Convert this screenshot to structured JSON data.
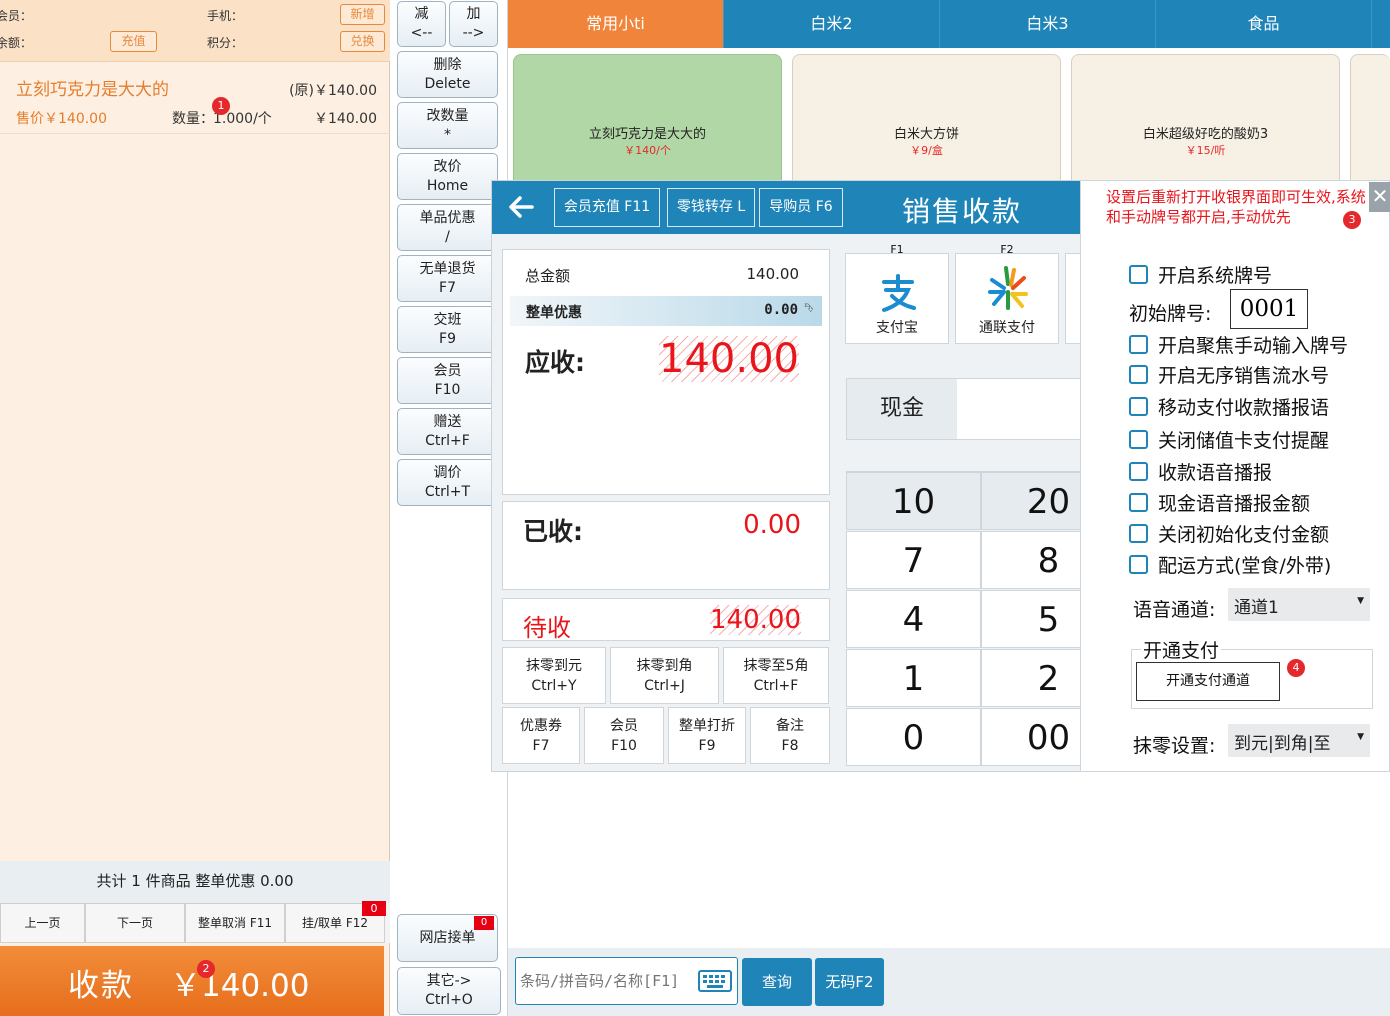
{
  "member_panel": {
    "member_label": "会员：",
    "phone_label": "手机：",
    "balance_label": "余额：",
    "points_label": "积分：",
    "new_button": "新增",
    "recharge_button": "充值",
    "redeem_button": "兑换"
  },
  "cart": {
    "items": [
      {
        "name": "立刻巧克力是大大的",
        "original_price": "(原)￥140.00",
        "sale_price": "售价￥140.00",
        "quantity_label": "数量：",
        "quantity": "1.000/个",
        "total": "￥140.00"
      }
    ],
    "summary": "共计 1 件商品 整单优惠 0.00",
    "pager": {
      "prev": "上一页",
      "next": "下一页",
      "cancel_order": "整单取消 F11",
      "hold_order": "挂/取单 F12",
      "hold_count": "0"
    },
    "pay_button_label": "收款",
    "pay_button_amount": "￥140.00"
  },
  "badges": [
    "1",
    "2",
    "3",
    "4"
  ],
  "function_buttons": {
    "decrease": {
      "line1": "减",
      "line2": "<--"
    },
    "increase": {
      "line1": "加",
      "line2": "-->"
    },
    "items": [
      {
        "line1": "删除",
        "line2": "Delete"
      },
      {
        "line1": "改数量",
        "line2": "*"
      },
      {
        "line1": "改价",
        "line2": "Home"
      },
      {
        "line1": "单品优惠",
        "line2": "/"
      },
      {
        "line1": "无单退货",
        "line2": "F7"
      },
      {
        "line1": "交班",
        "line2": "F9"
      },
      {
        "line1": "会员",
        "line2": "F10"
      },
      {
        "line1": "赠送",
        "line2": "Ctrl+F"
      },
      {
        "line1": "调价",
        "line2": "Ctrl+T"
      }
    ],
    "online_orders": "网店接单",
    "online_orders_count": "0",
    "other": {
      "line1": "其它->",
      "line2": "Ctrl+O"
    }
  },
  "categories": [
    {
      "label": "常用小ti",
      "active": true
    },
    {
      "label": "白米2",
      "active": false
    },
    {
      "label": "白米3",
      "active": false
    },
    {
      "label": "食品",
      "active": false
    }
  ],
  "products": [
    {
      "name": "立刻巧克力是大大的",
      "price": "￥140/个",
      "selected": true
    },
    {
      "name": "白米大方饼",
      "price": "￥9/盒",
      "selected": false
    },
    {
      "name": "白米超级好吃的酸奶3",
      "price": "￥15/听",
      "selected": false
    }
  ],
  "bottom_bar": {
    "search_placeholder": "条码/拼音码/名称[F1]",
    "query_button": "查询",
    "no_code_button": "无码F2",
    "keyboard_icon": "keyboard-icon"
  },
  "payment_dialog": {
    "title": "销售收款",
    "header_buttons": [
      "会员充值 F11",
      "零钱转存 L",
      "导购员 F6"
    ],
    "total_label": "总金额",
    "total": "140.00",
    "discount_label": "整单优惠",
    "discount": "0.00",
    "due_label": "应收:",
    "due": "140.00",
    "paid_label": "已收:",
    "paid": "0.00",
    "remaining_label": "待收",
    "remaining": "140.00",
    "rounding_buttons": [
      {
        "line1": "抹零到元",
        "line2": "Ctrl+Y"
      },
      {
        "line1": "抹零到角",
        "line2": "Ctrl+J"
      },
      {
        "line1": "抹零至5角",
        "line2": "Ctrl+F"
      }
    ],
    "action_buttons": [
      {
        "line1": "优惠券",
        "line2": "F7"
      },
      {
        "line1": "会员",
        "line2": "F10"
      },
      {
        "line1": "整单打折",
        "line2": "F9"
      },
      {
        "line1": "备注",
        "line2": "F8"
      }
    ],
    "payment_methods": [
      {
        "key": "F1",
        "label": "支付宝",
        "icon": "alipay-icon"
      },
      {
        "key": "F2",
        "label": "通联支付",
        "icon": "allinpay-icon"
      }
    ],
    "cash_label": "现金",
    "cash_value": "",
    "keypad": [
      "10",
      "20",
      "7",
      "8",
      "4",
      "5",
      "1",
      "2",
      "0",
      "00"
    ]
  },
  "settings_panel": {
    "note": "设置后重新打开收银界面即可生效,系统和手动牌号都开启,手动优先",
    "options": [
      "开启系统牌号",
      "开启聚焦手动输入牌号",
      "开启无序销售流水号",
      "移动支付收款播报语",
      "关闭储值卡支付提醒",
      "收款语音播报",
      "现金语音播报金额",
      "关闭初始化支付金额",
      "配运方式(堂食/外带)"
    ],
    "start_number_label": "初始牌号:",
    "start_number": "0001",
    "voice_channel_label": "语音通道:",
    "voice_channel": "通道1",
    "open_payment_legend": "开通支付",
    "open_payment_button": "开通支付通道",
    "rounding_label": "抹零设置:",
    "rounding_value": "到元|到角|至"
  },
  "colors": {
    "primary_blue": "#1f85b8",
    "accent_orange": "#f0843a",
    "alert_red": "#e8151b",
    "selected_green": "#b2d7a6"
  }
}
